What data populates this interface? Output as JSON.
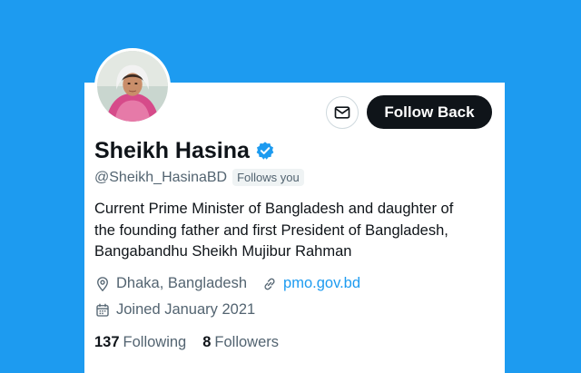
{
  "profile": {
    "name": "Sheikh Hasina",
    "handle": "@Sheikh_HasinaBD",
    "follows_you": "Follows you",
    "verified": true,
    "bio_lines": [
      "Current Prime Minister of Bangladesh and daughter of",
      "the founding father and first President of Bangladesh,",
      "Bangabandhu Sheikh Mujibur Rahman"
    ],
    "location": "Dhaka, Bangladesh",
    "website": "pmo.gov.bd",
    "joined": "Joined January 2021"
  },
  "actions": {
    "follow_back_label": "Follow Back",
    "message_icon": "envelope-icon"
  },
  "stats": {
    "following_count": "137",
    "following_label": "Following",
    "followers_count": "8",
    "followers_label": "Followers"
  },
  "colors": {
    "background": "#1d9bf0",
    "accent": "#1d9bf0",
    "text": "#0f1419",
    "muted": "#536471",
    "button_dark": "#0f1419"
  }
}
